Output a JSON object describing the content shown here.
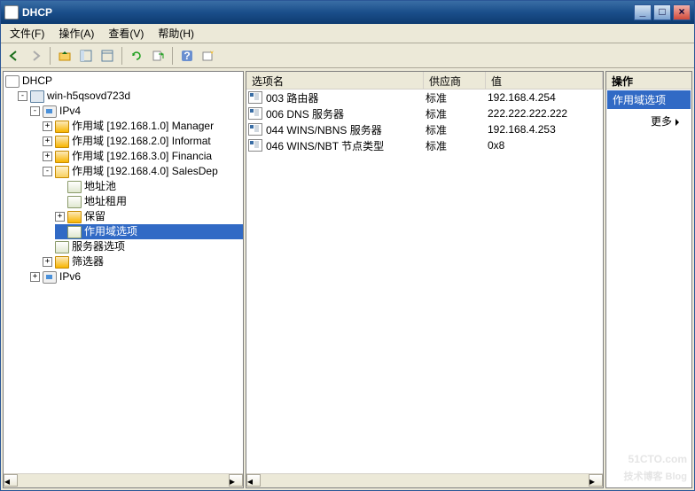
{
  "window": {
    "title": "DHCP"
  },
  "menu": {
    "file": "文件(F)",
    "action": "操作(A)",
    "view": "查看(V)",
    "help": "帮助(H)"
  },
  "tree": {
    "root": "DHCP",
    "server": "win-h5qsovd723d",
    "ipv4": "IPv4",
    "ipv6": "IPv6",
    "scope1": "作用域 [192.168.1.0] Manager",
    "scope2": "作用域 [192.168.2.0] Informat",
    "scope3": "作用域 [192.168.3.0] Financia",
    "scope4": "作用域 [192.168.4.0] SalesDep",
    "pool": "地址池",
    "lease": "地址租用",
    "reserve": "保留",
    "scope_options": "作用域选项",
    "server_options": "服务器选项",
    "filters": "筛选器"
  },
  "list": {
    "hdr_name": "选项名",
    "hdr_vendor": "供应商",
    "hdr_value": "值",
    "rows": [
      {
        "name": "003 路由器",
        "vendor": "标准",
        "value": "192.168.4.254"
      },
      {
        "name": "006 DNS 服务器",
        "vendor": "标准",
        "value": "222.222.222.222"
      },
      {
        "name": "044 WINS/NBNS 服务器",
        "vendor": "标准",
        "value": "192.168.4.253"
      },
      {
        "name": "046 WINS/NBT 节点类型",
        "vendor": "标准",
        "value": "0x8"
      }
    ]
  },
  "actions": {
    "header": "操作",
    "context": "作用域选项",
    "more": "更多"
  },
  "watermark": {
    "site": "51CTO.com",
    "sub": "技术博客   Blog"
  }
}
